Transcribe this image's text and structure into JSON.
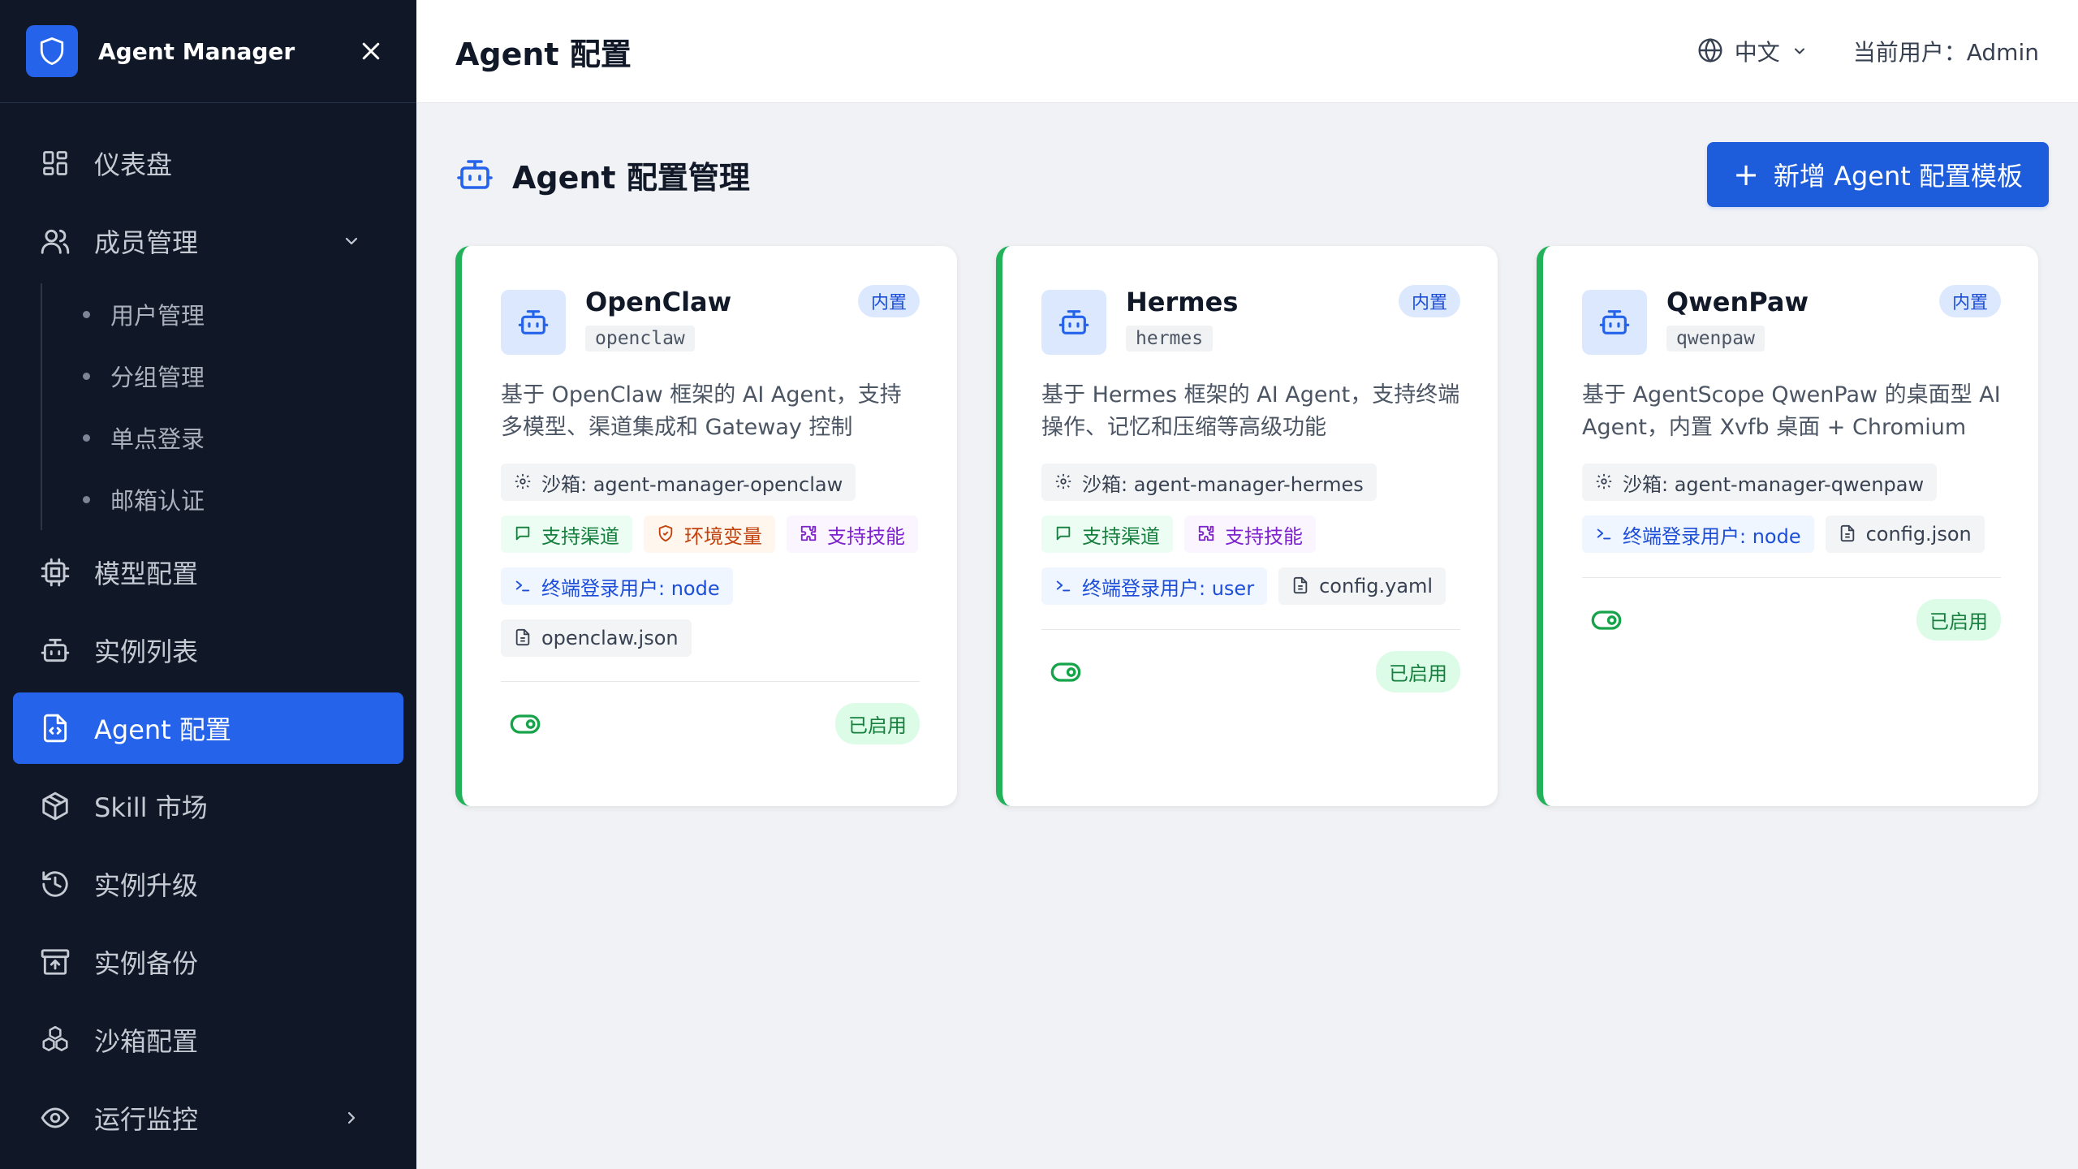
{
  "sidebar": {
    "brand": "Agent Manager",
    "items": [
      {
        "label": "仪表盘",
        "icon": "dashboard-icon"
      },
      {
        "label": "成员管理",
        "icon": "users-icon"
      },
      {
        "label": "模型配置",
        "icon": "cpu-icon"
      },
      {
        "label": "实例列表",
        "icon": "bot-icon"
      },
      {
        "label": "Agent 配置",
        "icon": "file-code-icon"
      },
      {
        "label": "Skill 市场",
        "icon": "package-icon"
      },
      {
        "label": "实例升级",
        "icon": "history-icon"
      },
      {
        "label": "实例备份",
        "icon": "archive-icon"
      },
      {
        "label": "沙箱配置",
        "icon": "boxes-icon"
      },
      {
        "label": "运行监控",
        "icon": "eye-icon"
      }
    ],
    "sub_items": [
      "用户管理",
      "分组管理",
      "单点登录",
      "邮箱认证"
    ],
    "active": "Agent 配置"
  },
  "header": {
    "title": "Agent 配置",
    "language": "中文",
    "user": "当前用户：Admin"
  },
  "main": {
    "section_title": "Agent 配置管理",
    "add_button": "新增 Agent 配置模板",
    "cards": [
      {
        "name": "OpenClaw",
        "slug": "openclaw",
        "badge": "内置",
        "description": "基于 OpenClaw 框架的 AI Agent，支持多模型、渠道集成和 Gateway 控制",
        "sandbox": "沙箱: agent-manager-openclaw",
        "channel": "支持渠道",
        "env": "环境变量",
        "skills": "支持技能",
        "terminal": "终端登录用户: node",
        "config": "openclaw.json",
        "status": "已启用"
      },
      {
        "name": "Hermes",
        "slug": "hermes",
        "badge": "内置",
        "description": "基于 Hermes 框架的 AI Agent，支持终端操作、记忆和压缩等高级功能",
        "sandbox": "沙箱: agent-manager-hermes",
        "channel": "支持渠道",
        "skills": "支持技能",
        "terminal": "终端登录用户: user",
        "config": "config.yaml",
        "status": "已启用"
      },
      {
        "name": "QwenPaw",
        "slug": "qwenpaw",
        "badge": "内置",
        "description": "基于 AgentScope QwenPaw 的桌面型 AI Agent，内置 Xvfb 桌面 + Chromium +...",
        "sandbox": "沙箱: agent-manager-qwenpaw",
        "terminal": "终端登录用户: node",
        "config": "config.json",
        "status": "已启用"
      }
    ]
  },
  "colors": {
    "sidebar_bg": "#101828",
    "accent": "#2563eb",
    "card_border": "#22b35a",
    "status_green": "#15803d"
  }
}
